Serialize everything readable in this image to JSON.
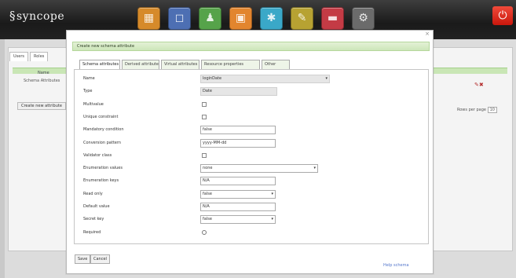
{
  "app": {
    "brand": "syncope",
    "brand_mark": "§",
    "toolbar": [
      {
        "name": "schema",
        "color": "#d68a2a",
        "glyph": "▦"
      },
      {
        "name": "users",
        "color": "#4d6fb3",
        "glyph": "◻"
      },
      {
        "name": "roles",
        "color": "#56a34a",
        "glyph": "♟"
      },
      {
        "name": "resources",
        "color": "#e2852e",
        "glyph": "▣"
      },
      {
        "name": "connectors",
        "color": "#3aa8c8",
        "glyph": "✱"
      },
      {
        "name": "reports",
        "color": "#b7a232",
        "glyph": "✎"
      },
      {
        "name": "tasks",
        "color": "#c43b45",
        "glyph": "▬"
      },
      {
        "name": "configuration",
        "color": "#6b6b6b",
        "glyph": "⚙"
      }
    ],
    "power_glyph": "⏻"
  },
  "background": {
    "tabs": [
      "Users",
      "Roles"
    ],
    "row_label": "Schema Attributes",
    "header_label": "Name",
    "button_label": "Create new attribute",
    "pager_label": "Rows per page",
    "pager_value": "10"
  },
  "modal": {
    "close_glyph": "×",
    "title": "Create new schema attribute",
    "tabs": [
      {
        "label": "Schema attributes",
        "active": true
      },
      {
        "label": "Derived attributes",
        "active": false
      },
      {
        "label": "Virtual attributes",
        "active": false
      },
      {
        "label": "Resource properties",
        "active": false
      },
      {
        "label": "Other",
        "active": false
      }
    ],
    "rows": [
      {
        "label": "Name",
        "kind": "select-readonly",
        "value": "loginDate"
      },
      {
        "label": "Type",
        "kind": "field-readonly",
        "value": "Date"
      },
      {
        "label": "Multivalue",
        "kind": "checkbox",
        "value": ""
      },
      {
        "label": "Unique constraint",
        "kind": "checkbox",
        "value": ""
      },
      {
        "label": "Mandatory condition",
        "kind": "field",
        "value": "false"
      },
      {
        "label": "Conversion pattern",
        "kind": "field",
        "value": "yyyy-MM-dd"
      },
      {
        "label": "Validator class",
        "kind": "checkbox",
        "value": ""
      },
      {
        "label": "Enumeration values",
        "kind": "select",
        "value": "none"
      },
      {
        "label": "Enumeration keys",
        "kind": "field",
        "value": "N/A"
      },
      {
        "label": "Read only",
        "kind": "select",
        "value": "false"
      },
      {
        "label": "Default value",
        "kind": "field",
        "value": "N/A"
      },
      {
        "label": "Secret key",
        "kind": "select",
        "value": "false"
      },
      {
        "label": "Required",
        "kind": "radio",
        "value": ""
      }
    ],
    "buttons": {
      "save": "Save",
      "cancel": "Cancel"
    },
    "help_link": "Help schema"
  }
}
